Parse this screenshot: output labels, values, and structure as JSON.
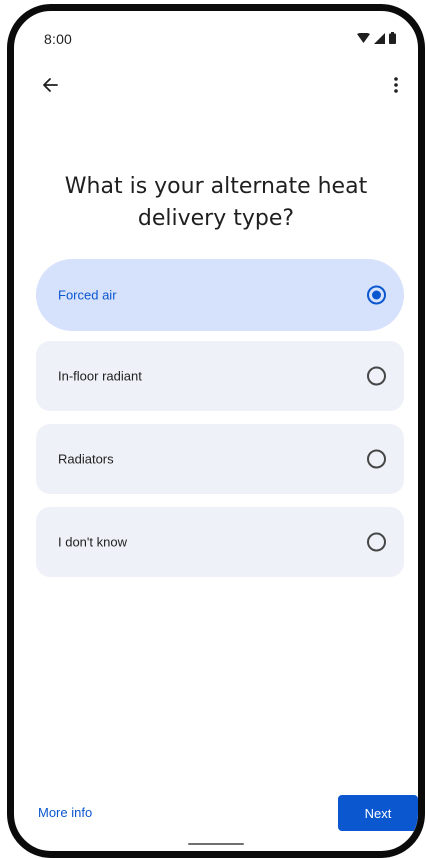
{
  "status_bar": {
    "time": "8:00",
    "icons": [
      "wifi-icon",
      "signal-icon",
      "battery-icon"
    ]
  },
  "app_bar": {
    "back_icon": "arrow-back-icon",
    "menu_icon": "more-vert-icon"
  },
  "question": {
    "title": "What is your alternate heat delivery type?"
  },
  "options": [
    {
      "label": "Forced air",
      "selected": true
    },
    {
      "label": "In-floor radiant",
      "selected": false
    },
    {
      "label": "Radiators",
      "selected": false
    },
    {
      "label": "I don't know",
      "selected": false
    }
  ],
  "footer": {
    "more_info_label": "More info",
    "next_label": "Next"
  },
  "colors": {
    "accent": "#0b57d0",
    "selected_bg": "#d6e1fb",
    "option_bg": "#eef1f7"
  }
}
